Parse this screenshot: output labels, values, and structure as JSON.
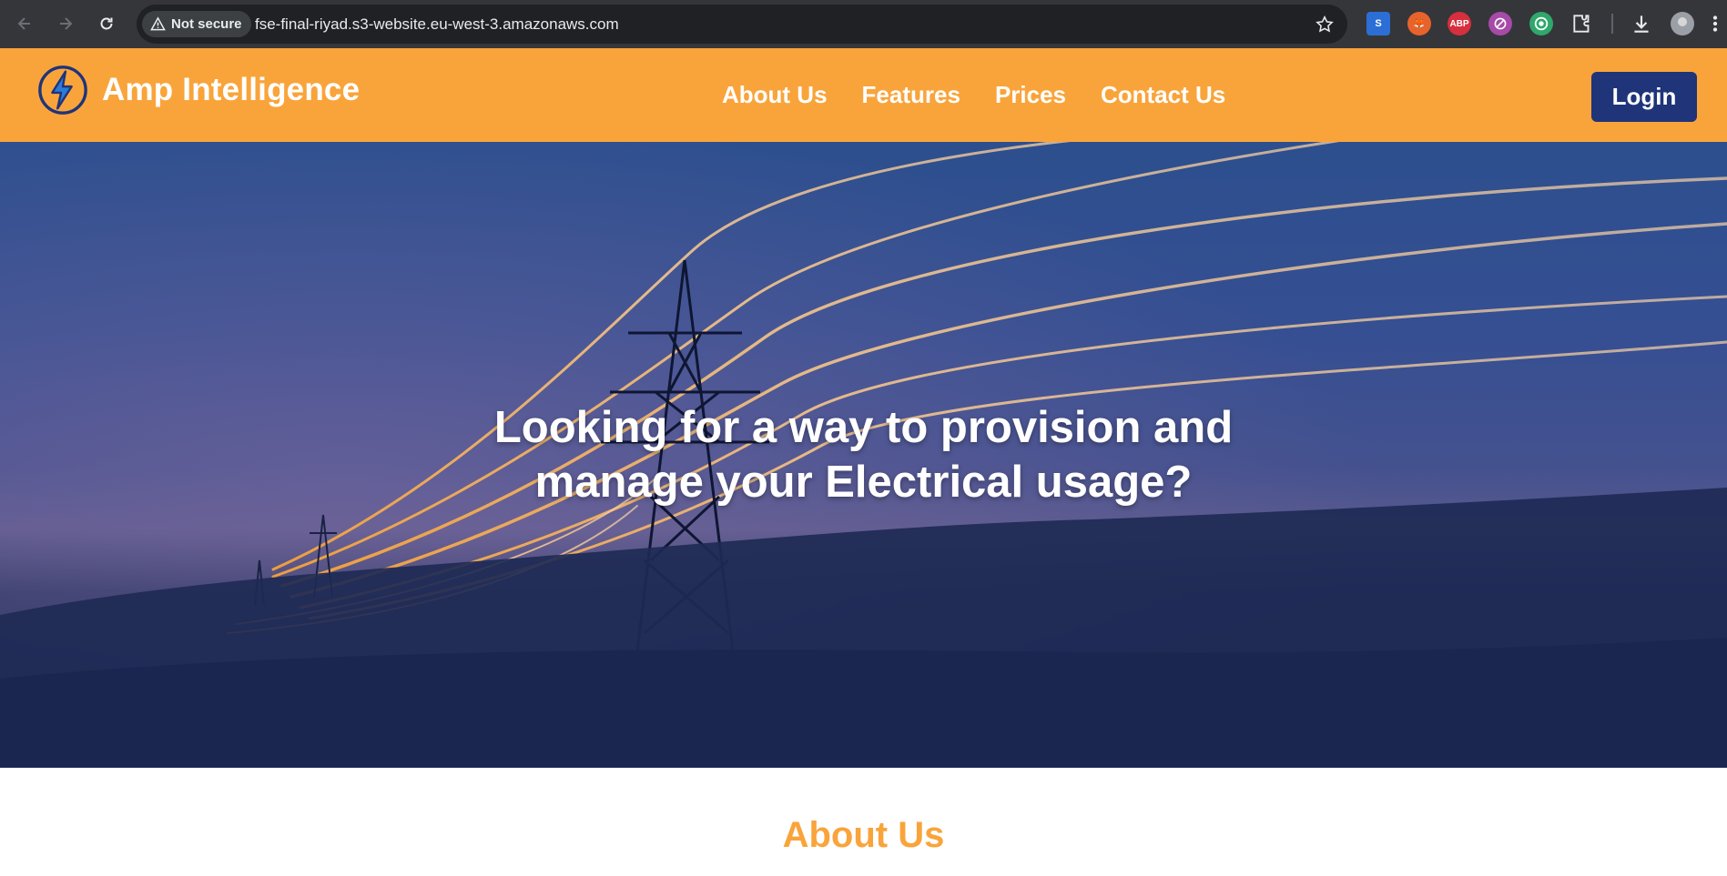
{
  "browser": {
    "security_label": "Not secure",
    "url": "fse-final-riyad.s3-website.eu-west-3.amazonaws.com",
    "extensions": [
      {
        "icon": "translate-extension-icon",
        "label": ""
      },
      {
        "icon": "fox-extension-icon",
        "label": ""
      },
      {
        "icon": "adblock-plus-icon",
        "label": "ABP"
      },
      {
        "icon": "blocker-extension-icon",
        "label": ""
      },
      {
        "icon": "target-extension-icon",
        "label": ""
      }
    ]
  },
  "header": {
    "brand": "Amp Intelligence",
    "nav": [
      "About Us",
      "Features",
      "Prices",
      "Contact Us"
    ],
    "login_label": "Login",
    "colors": {
      "accent": "#f9a43b",
      "login_bg": "#1f3479"
    }
  },
  "hero": {
    "title_line1": "Looking for a way to provision and",
    "title_line2": "manage your Electrical usage?"
  },
  "about": {
    "heading": "About Us"
  }
}
